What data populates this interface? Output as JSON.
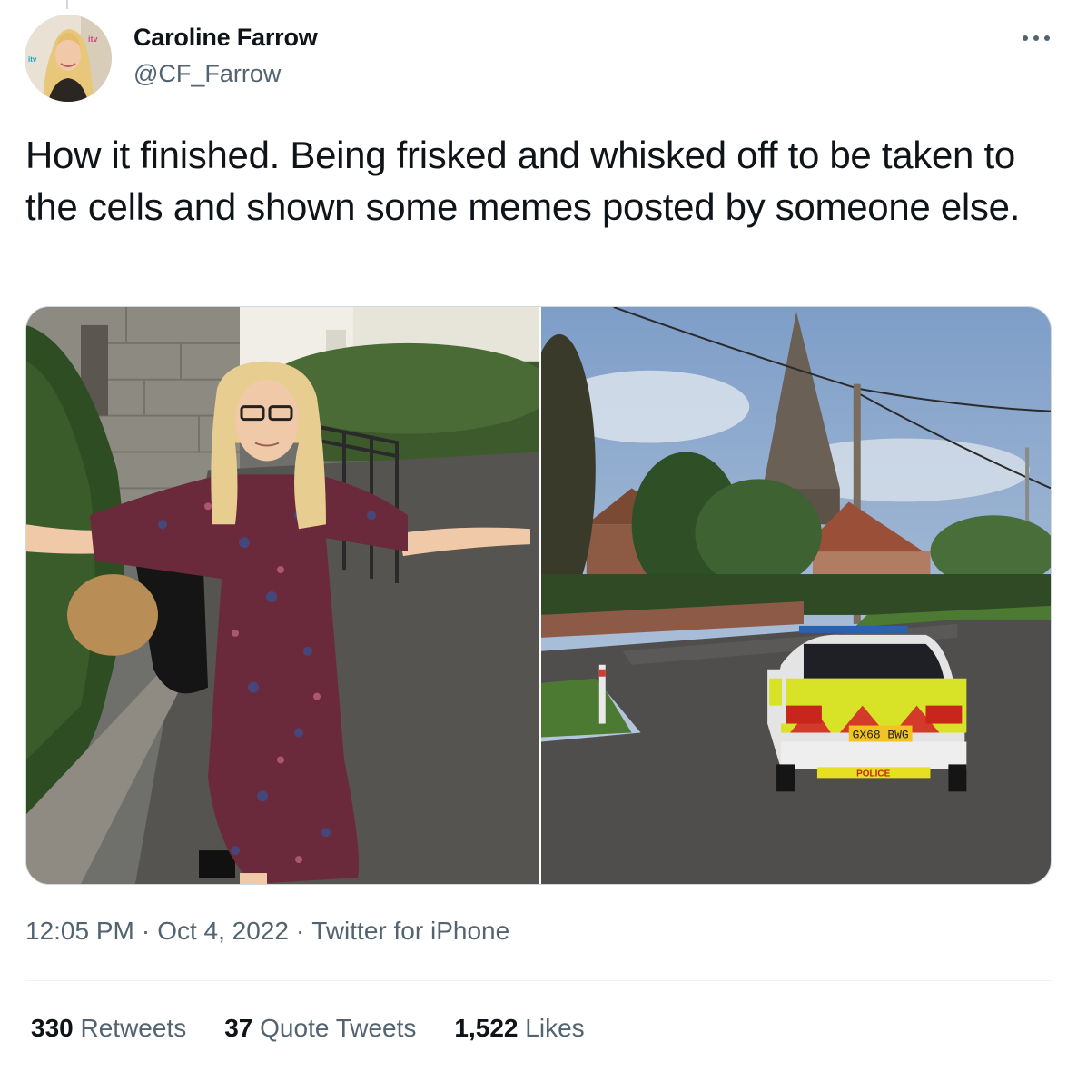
{
  "user": {
    "name": "Caroline Farrow",
    "handle": "@CF_Farrow"
  },
  "tweet": {
    "text": "How it finished. Being frisked and whisked off to be taken to the cells and shown some memes posted by someone else."
  },
  "media": {
    "count": 2,
    "car_plate": "GX68 BWG",
    "car_label": "POLICE"
  },
  "meta": {
    "time": "12:05 PM",
    "date": "Oct 4, 2022",
    "source": "Twitter for iPhone",
    "separator": "·"
  },
  "stats": {
    "retweets_count": "330",
    "retweets_label": "Retweets",
    "quotes_count": "37",
    "quotes_label": "Quote Tweets",
    "likes_count": "1,522",
    "likes_label": "Likes"
  },
  "icons": {
    "more": "more-horizontal-icon"
  },
  "colors": {
    "text_primary": "#0f1419",
    "text_secondary": "#536471",
    "divider": "#eff3f4"
  }
}
